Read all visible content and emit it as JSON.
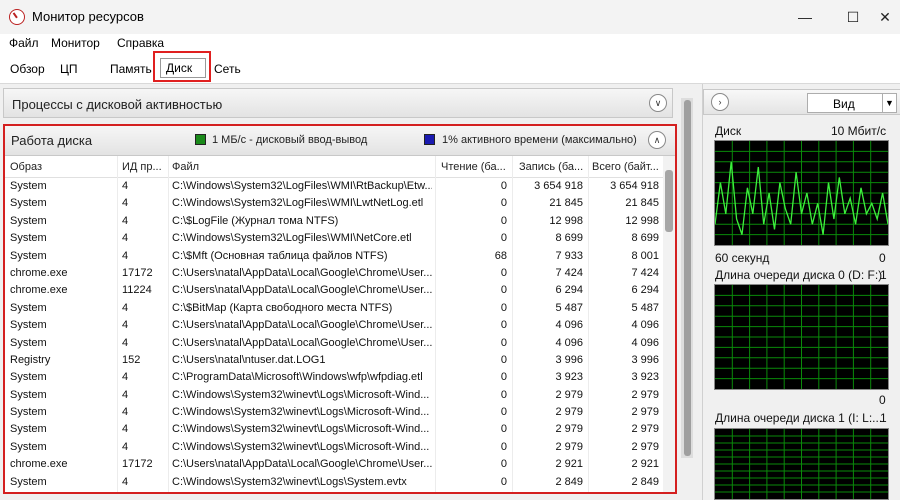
{
  "window": {
    "title": "Монитор ресурсов",
    "controls": [
      "—",
      "☐",
      "✕"
    ]
  },
  "menu": [
    "Файл",
    "Монитор",
    "Справка"
  ],
  "tabs": {
    "items": [
      "Обзор",
      "ЦП",
      "Память",
      "Диск",
      "Сеть"
    ],
    "active": "Диск"
  },
  "processes_section": {
    "title": "Процессы с дисковой активностью"
  },
  "disk_section": {
    "title": "Работа диска",
    "legend": [
      {
        "label": "1 МБ/с - дисковый ввод-вывод",
        "color": "#1a8a1a"
      },
      {
        "label": "1% активного времени (максимально)",
        "color": "#1a1ab0"
      }
    ],
    "columns": [
      "Образ",
      "ИД пр...",
      "Файл",
      "Чтение (ба...",
      "Запись (ба...",
      "Всего (байт..."
    ],
    "rows": [
      [
        "System",
        "4",
        "C:\\Windows\\System32\\LogFiles\\WMI\\RtBackup\\Etw...",
        "0",
        "3 654 918",
        "3 654 918"
      ],
      [
        "System",
        "4",
        "C:\\Windows\\System32\\LogFiles\\WMI\\LwtNetLog.etl",
        "0",
        "21 845",
        "21 845"
      ],
      [
        "System",
        "4",
        "C:\\$LogFile (Журнал тома NTFS)",
        "0",
        "12 998",
        "12 998"
      ],
      [
        "System",
        "4",
        "C:\\Windows\\System32\\LogFiles\\WMI\\NetCore.etl",
        "0",
        "8 699",
        "8 699"
      ],
      [
        "System",
        "4",
        "C:\\$Mft (Основная таблица файлов NTFS)",
        "68",
        "7 933",
        "8 001"
      ],
      [
        "chrome.exe",
        "17172",
        "C:\\Users\\natal\\AppData\\Local\\Google\\Chrome\\User...",
        "0",
        "7 424",
        "7 424"
      ],
      [
        "chrome.exe",
        "11224",
        "C:\\Users\\natal\\AppData\\Local\\Google\\Chrome\\User...",
        "0",
        "6 294",
        "6 294"
      ],
      [
        "System",
        "4",
        "C:\\$BitMap (Карта свободного места NTFS)",
        "0",
        "5 487",
        "5 487"
      ],
      [
        "System",
        "4",
        "C:\\Users\\natal\\AppData\\Local\\Google\\Chrome\\User...",
        "0",
        "4 096",
        "4 096"
      ],
      [
        "System",
        "4",
        "C:\\Users\\natal\\AppData\\Local\\Google\\Chrome\\User...",
        "0",
        "4 096",
        "4 096"
      ],
      [
        "Registry",
        "152",
        "C:\\Users\\natal\\ntuser.dat.LOG1",
        "0",
        "3 996",
        "3 996"
      ],
      [
        "System",
        "4",
        "C:\\ProgramData\\Microsoft\\Windows\\wfp\\wfpdiag.etl",
        "0",
        "3 923",
        "3 923"
      ],
      [
        "System",
        "4",
        "C:\\Windows\\System32\\winevt\\Logs\\Microsoft-Wind...",
        "0",
        "2 979",
        "2 979"
      ],
      [
        "System",
        "4",
        "C:\\Windows\\System32\\winevt\\Logs\\Microsoft-Wind...",
        "0",
        "2 979",
        "2 979"
      ],
      [
        "System",
        "4",
        "C:\\Windows\\System32\\winevt\\Logs\\Microsoft-Wind...",
        "0",
        "2 979",
        "2 979"
      ],
      [
        "System",
        "4",
        "C:\\Windows\\System32\\winevt\\Logs\\Microsoft-Wind...",
        "0",
        "2 979",
        "2 979"
      ],
      [
        "chrome.exe",
        "17172",
        "C:\\Users\\natal\\AppData\\Local\\Google\\Chrome\\User...",
        "0",
        "2 921",
        "2 921"
      ],
      [
        "System",
        "4",
        "C:\\Windows\\System32\\winevt\\Logs\\System.evtx",
        "0",
        "2 849",
        "2 849"
      ]
    ]
  },
  "right_panel": {
    "view_label": "Вид",
    "graphs": [
      {
        "title": "Диск",
        "max": "10 Мбит/с",
        "footer_left": "60 секунд",
        "footer_right": "0"
      },
      {
        "title": "Длина очереди диска 0 (D: F:)",
        "max": "1",
        "footer_left": "",
        "footer_right": "0"
      },
      {
        "title": "Длина очереди диска 1 (I: L:...",
        "max": "1",
        "footer_left": "",
        "footer_right": ""
      }
    ],
    "colors": {
      "grid": "#0a8a0a",
      "line": "#3df03d",
      "bg": "#000000"
    }
  }
}
